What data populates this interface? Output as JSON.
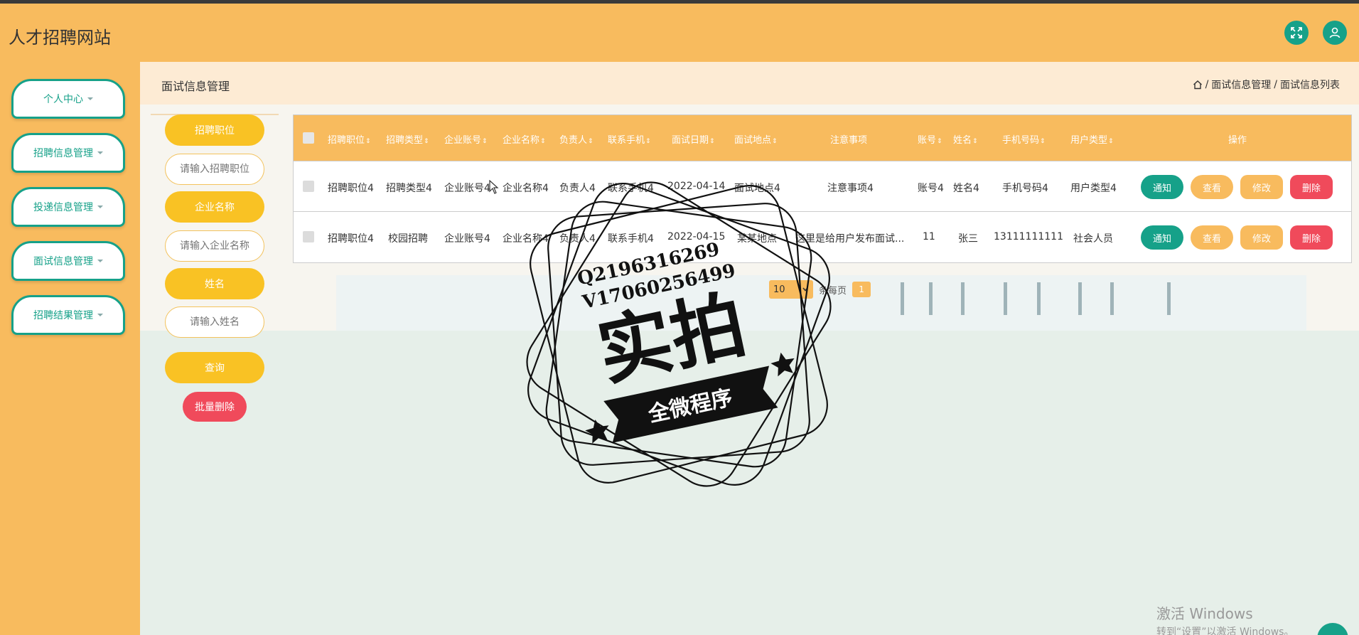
{
  "app": {
    "title": "人才招聘网站"
  },
  "header": {
    "fullscreen_icon": "expand-icon",
    "user_icon": "user-icon"
  },
  "sidebar": {
    "items": [
      {
        "label": "个人中心"
      },
      {
        "label": "招聘信息管理"
      },
      {
        "label": "投递信息管理"
      },
      {
        "label": "面试信息管理"
      },
      {
        "label": "招聘结果管理"
      }
    ]
  },
  "page": {
    "title": "面试信息管理",
    "breadcrumb": {
      "home_icon": "home-icon",
      "sep": "/",
      "level1": "面试信息管理",
      "level2": "面试信息列表"
    }
  },
  "filters": {
    "position_label": "招聘职位",
    "position_placeholder": "请输入招聘职位",
    "company_label": "企业名称",
    "company_placeholder": "请输入企业名称",
    "name_label": "姓名",
    "name_placeholder": "请输入姓名",
    "search_label": "查询",
    "batch_delete_label": "批量删除"
  },
  "table": {
    "columns": [
      "招聘职位",
      "招聘类型",
      "企业账号",
      "企业名称",
      "负责人",
      "联系手机",
      "面试日期",
      "面试地点",
      "注意事项",
      "账号",
      "姓名",
      "手机号码",
      "用户类型",
      "操作"
    ],
    "rows": [
      [
        "招聘职位4",
        "招聘类型4",
        "企业账号4",
        "企业名称4",
        "负责人4",
        "联系手机4",
        "2022-04-14",
        "面试地点4",
        "注意事项4",
        "账号4",
        "姓名4",
        "手机号码4",
        "用户类型4"
      ],
      [
        "招聘职位4",
        "校园招聘",
        "企业账号4",
        "企业名称4",
        "负责人4",
        "联系手机4",
        "2022-04-15",
        "某某地点",
        "这里是给用户发布面试...",
        "11",
        "张三",
        "13111111111",
        "社会人员"
      ]
    ],
    "actions": {
      "notify": "通知",
      "view": "查看",
      "edit": "修改",
      "delete": "删除"
    }
  },
  "pagination": {
    "page_size": "10",
    "per_page_label": "条每页",
    "current_page": "1"
  },
  "watermark": {
    "line1": "Q2196316269",
    "line2": "V17060256499",
    "big": "实拍",
    "banner": "全微程序"
  },
  "os_overlay": {
    "line1": "激活 Windows",
    "line2": "转到“设置”以激活 Windows。"
  },
  "colors": {
    "primary": "#f8bb5e",
    "teal": "#16a189",
    "yellow": "#f9c224",
    "danger": "#f04a5b"
  }
}
